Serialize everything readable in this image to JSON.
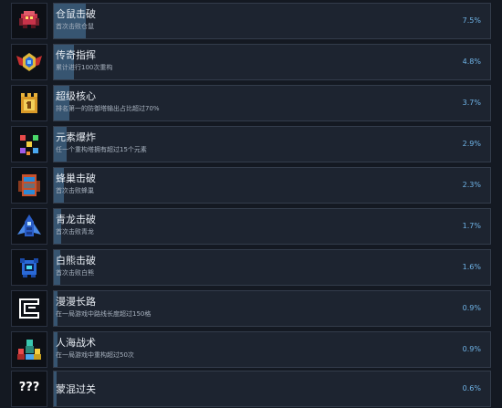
{
  "achievements": [
    {
      "title": "仓鼠击破",
      "description": "首次击败仓鼠",
      "percent_label": "7.5%",
      "percent": 7.5,
      "icon": "red-mech-icon"
    },
    {
      "title": "传奇指挥",
      "description": "累计进行100次重构",
      "percent_label": "4.8%",
      "percent": 4.8,
      "icon": "winged-crest-icon"
    },
    {
      "title": "超级核心",
      "description": "排名第一的防御塔输出占比超过70%",
      "percent_label": "3.7%",
      "percent": 3.7,
      "icon": "gold-tower-icon"
    },
    {
      "title": "元素爆炸",
      "description": "任一个重构塔拥有超过15个元素",
      "percent_label": "2.9%",
      "percent": 2.9,
      "icon": "element-dice-icon"
    },
    {
      "title": "蜂巢击破",
      "description": "首次击败蜂巢",
      "percent_label": "2.3%",
      "percent": 2.3,
      "icon": "hive-robot-icon"
    },
    {
      "title": "青龙击破",
      "description": "首次击败青龙",
      "percent_label": "1.7%",
      "percent": 1.7,
      "icon": "blue-dragon-ship-icon"
    },
    {
      "title": "白熊击破",
      "description": "首次击败白熊",
      "percent_label": "1.6%",
      "percent": 1.6,
      "icon": "blue-bear-bot-icon"
    },
    {
      "title": "漫漫长路",
      "description": "在一局游戏中路线长度超过150格",
      "percent_label": "0.9%",
      "percent": 0.9,
      "icon": "maze-path-icon"
    },
    {
      "title": "人海战术",
      "description": "在一局游戏中重构超过50次",
      "percent_label": "0.9%",
      "percent": 0.9,
      "icon": "crowd-icon"
    },
    {
      "title": "蒙混过关",
      "description": "",
      "percent_label": "0.6%",
      "percent": 0.6,
      "icon": "question-marks-icon",
      "icon_text": "???"
    }
  ],
  "colors": {
    "background": "#141922",
    "panel": "#1d2430",
    "progress_fill": "#375571",
    "percent_text": "#6fb3e6"
  }
}
